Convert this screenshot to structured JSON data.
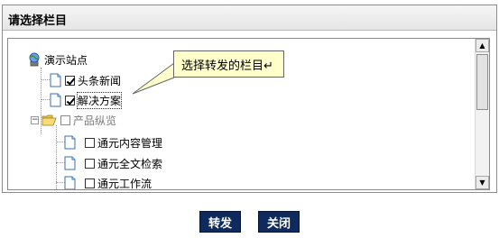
{
  "header": {
    "title": "请选择栏目"
  },
  "tree": {
    "root": {
      "label": "演示站点"
    },
    "items": [
      {
        "label": "头条新闻",
        "checked": true
      },
      {
        "label": "解决方案",
        "checked": true
      },
      {
        "label": "产品纵览",
        "checked": false,
        "expander": "⊟"
      },
      {
        "label": "通元内容管理",
        "checked": false
      },
      {
        "label": "通元全文检索",
        "checked": false
      },
      {
        "label": "通元工作流",
        "checked": false
      }
    ]
  },
  "tooltip": {
    "text": "选择转发的栏目↵"
  },
  "scrollbar": {
    "up_arrow": "▲",
    "down_arrow": "▼"
  },
  "buttons": {
    "forward": "转发",
    "close": "关闭"
  }
}
